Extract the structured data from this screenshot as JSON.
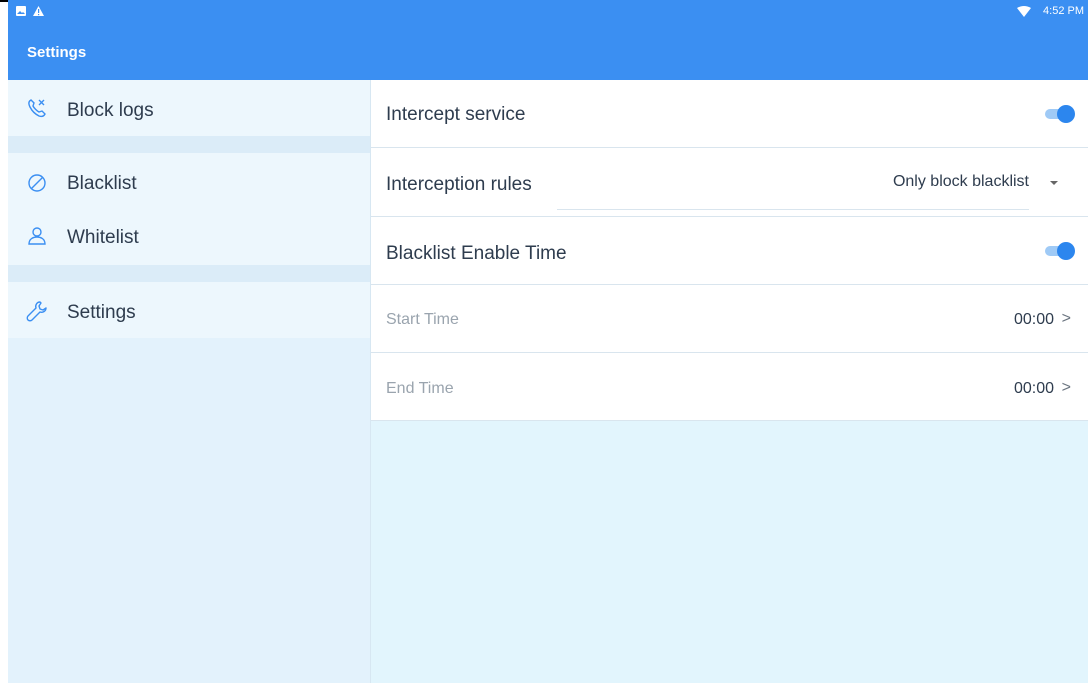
{
  "status_bar": {
    "time": "4:52 PM",
    "left_icons": [
      "image-icon",
      "warning-icon"
    ],
    "right_icons": [
      "wifi-icon"
    ]
  },
  "app_bar": {
    "title": "Settings"
  },
  "sidebar": {
    "items": [
      {
        "label": "Block logs",
        "icon": "phone-blocked-icon"
      },
      {
        "label": "Blacklist",
        "icon": "block-circle-icon"
      },
      {
        "label": "Whitelist",
        "icon": "user-icon"
      },
      {
        "label": "Settings",
        "icon": "wrench-icon"
      }
    ]
  },
  "settings": {
    "intercept_service": {
      "label": "Intercept service",
      "enabled": true
    },
    "interception_rules": {
      "label": "Interception rules",
      "value": "Only block blacklist"
    },
    "blacklist_enable_time": {
      "label": "Blacklist Enable Time",
      "enabled": true
    },
    "start_time": {
      "label": "Start Time",
      "value": "00:00",
      "chevron": ">"
    },
    "end_time": {
      "label": "End Time",
      "value": "00:00",
      "chevron": ">"
    }
  },
  "colors": {
    "primary": "#3b8ff2",
    "accent": "#2c86ee",
    "sidebar_bg": "#e3f2fc",
    "content_bg": "#e2f5fd",
    "text": "#2e3c4e",
    "muted_text": "#9aa4ae"
  }
}
